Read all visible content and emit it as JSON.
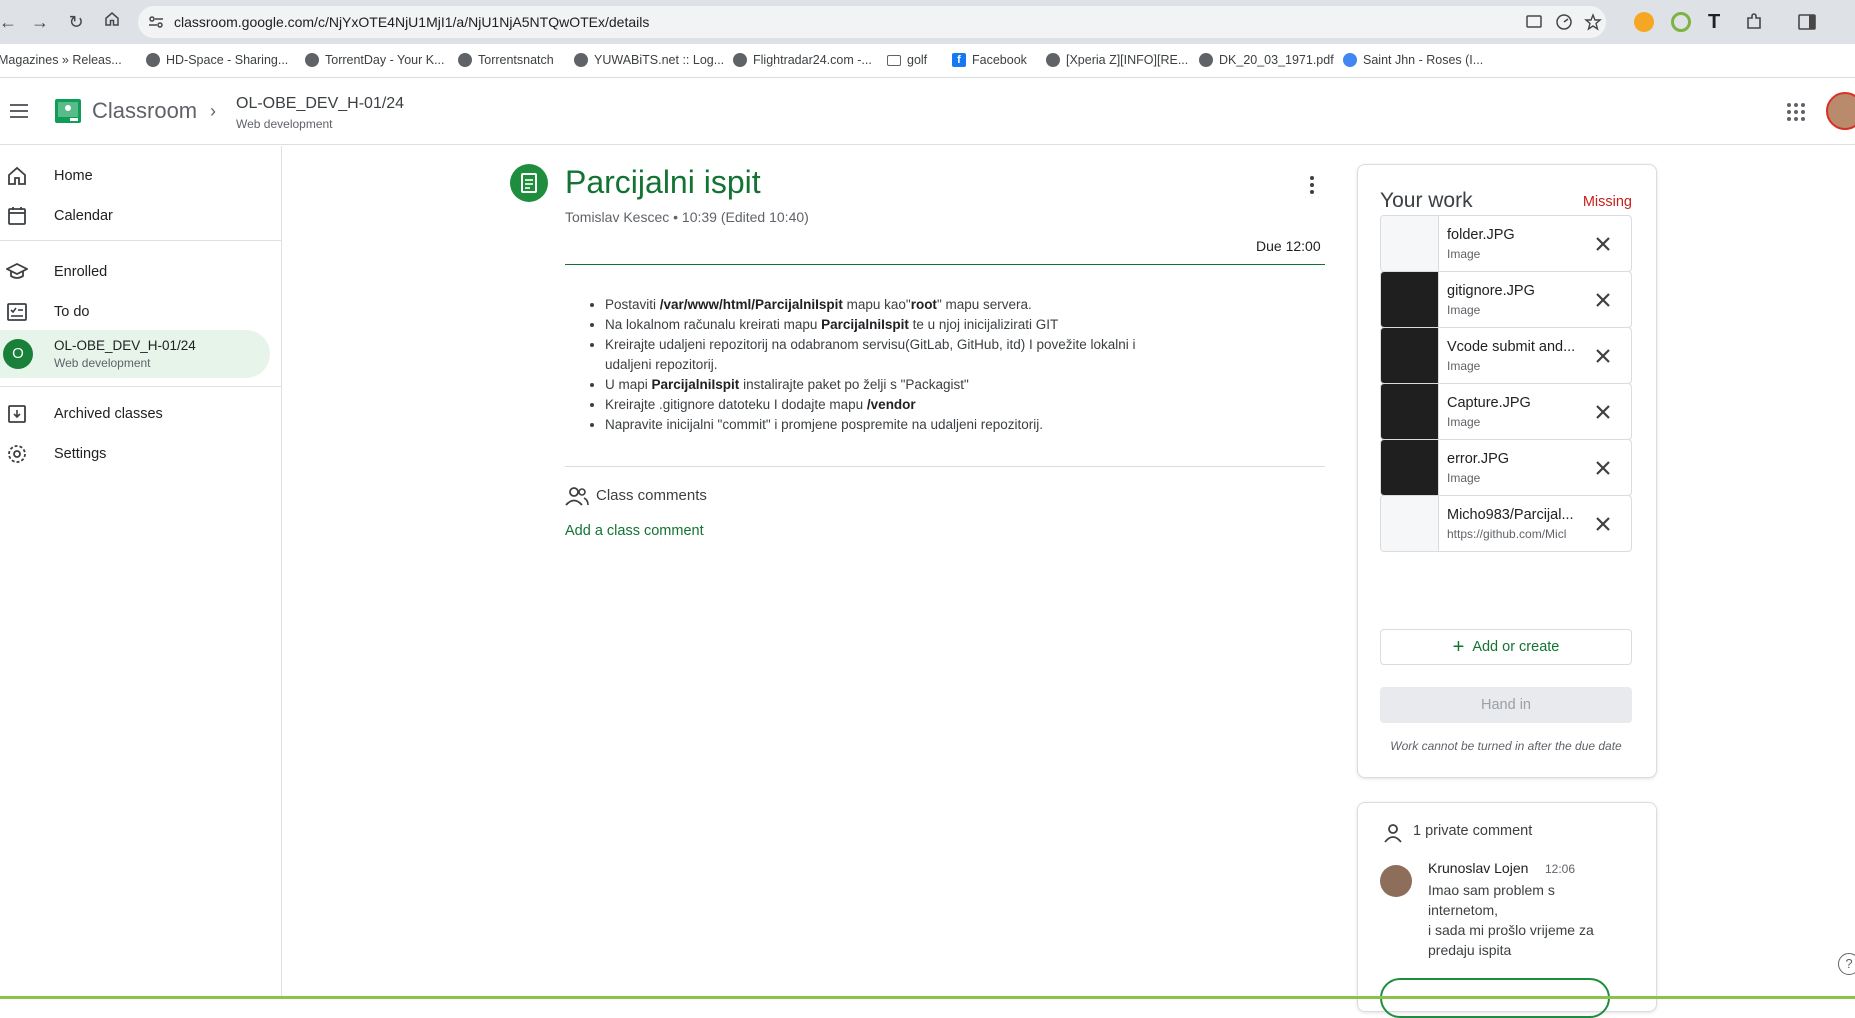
{
  "browser": {
    "url": "classroom.google.com/c/NjYxOTE4NjU1MjI1/a/NjU1NjA5NTQwOTEx/details",
    "bookmarks": [
      {
        "label": "Magazines » Releas...",
        "icon": "site-icon"
      },
      {
        "label": "HD-Space - Sharing...",
        "icon": "site-icon"
      },
      {
        "label": "TorrentDay - Your K...",
        "icon": "site-icon"
      },
      {
        "label": "Torrentsnatch",
        "icon": "site-icon"
      },
      {
        "label": "YUWABiTS.net :: Log...",
        "icon": "site-icon"
      },
      {
        "label": "Flightradar24.com -...",
        "icon": "site-icon"
      },
      {
        "label": "golf",
        "icon": "folder-icon"
      },
      {
        "label": "Facebook",
        "icon": "facebook-icon"
      },
      {
        "label": "[Xperia Z][INFO][RE...",
        "icon": "site-icon"
      },
      {
        "label": "DK_20_03_1971.pdf",
        "icon": "site-icon"
      },
      {
        "label": "Saint Jhn - Roses (I...",
        "icon": "play-icon"
      }
    ]
  },
  "header": {
    "app_title": "Classroom",
    "class_title": "OL-OBE_DEV_H-01/24",
    "class_subtitle": "Web development"
  },
  "sidebar": {
    "home": "Home",
    "calendar": "Calendar",
    "enrolled": "Enrolled",
    "todo": "To do",
    "active_class": {
      "initial": "O",
      "title": "OL-OBE_DEV_H-01/24",
      "subtitle": "Web development"
    },
    "archived": "Archived classes",
    "settings": "Settings"
  },
  "assignment": {
    "title": "Parcijalni ispit",
    "meta": "Tomislav Kescec • 10:39 (Edited 10:40)",
    "due": "Due 12:00",
    "instructions": [
      {
        "parts": [
          [
            "Postaviti ",
            false
          ],
          [
            "/var/www/html/ParcijalniIspit",
            true
          ],
          [
            " mapu kao\"",
            false
          ],
          [
            "root",
            true
          ],
          [
            "\" mapu servera.",
            false
          ]
        ]
      },
      {
        "parts": [
          [
            "Na lokalnom računalu kreirati mapu ",
            false
          ],
          [
            "ParcijalniIspit",
            true
          ],
          [
            " te u njoj inicijalizirati GIT",
            false
          ]
        ]
      },
      {
        "parts": [
          [
            "Kreirajte udaljeni repozitorij na odabranom servisu(GitLab, GitHub, itd) I povežite lokalni i udaljeni repozitorij.",
            false
          ]
        ]
      },
      {
        "parts": [
          [
            "U mapi ",
            false
          ],
          [
            "ParcijalniIspit",
            true
          ],
          [
            " instalirajte paket po želji s \"Packagist\"",
            false
          ]
        ]
      },
      {
        "parts": [
          [
            "Kreirajte .gitignore datoteku I dodajte mapu ",
            false
          ],
          [
            "/vendor",
            true
          ]
        ]
      },
      {
        "parts": [
          [
            "Napravite inicijalni \"commit\" i promjene pospremite na udaljeni repozitorij.",
            false
          ]
        ]
      }
    ],
    "comments_label": "Class comments",
    "add_comment": "Add a class comment"
  },
  "your_work": {
    "title": "Your work",
    "status": "Missing",
    "attachments": [
      {
        "name": "folder.JPG",
        "type": "Image",
        "thumb": "light"
      },
      {
        "name": "gitignore.JPG",
        "type": "Image",
        "thumb": "dark"
      },
      {
        "name": "Vcode submit and...",
        "type": "Image",
        "thumb": "dark"
      },
      {
        "name": "Capture.JPG",
        "type": "Image",
        "thumb": "dark"
      },
      {
        "name": "error.JPG",
        "type": "Image",
        "thumb": "dark"
      },
      {
        "name": "Micho983/Parcijal...",
        "type": "https://github.com/Micl",
        "thumb": "light"
      }
    ],
    "add_create": "Add or create",
    "hand_in": "Hand in",
    "note": "Work cannot be turned in after the due date"
  },
  "private_comments": {
    "title": "1 private comment",
    "author": "Krunoslav Lojen",
    "time": "12:06",
    "text": "Imao sam problem s internetom,\ni sada mi prošlo vrijeme za predaju ispita"
  },
  "colors": {
    "accent": "#137333",
    "missing": "#c5221f",
    "active_bg": "#e6f4ea"
  }
}
